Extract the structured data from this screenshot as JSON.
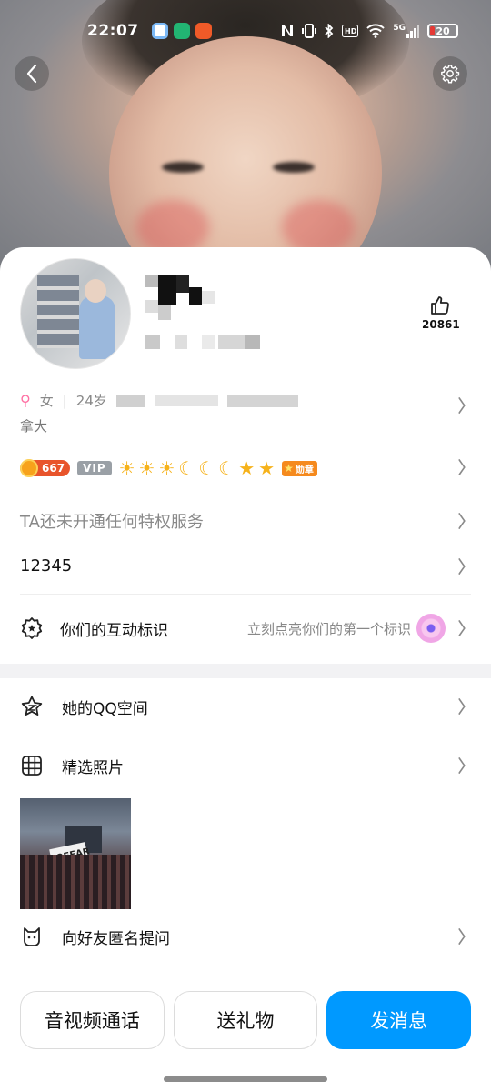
{
  "status_bar": {
    "time": "22:07",
    "network": "5G",
    "battery": "20"
  },
  "header": {
    "back_icon": "chevron-left-icon",
    "settings_icon": "gear-icon"
  },
  "profile": {
    "likes_count": "20861",
    "gender_symbol": "♀",
    "gender": "女",
    "age": "24岁",
    "location_line2": "拿大",
    "level": "667",
    "vip_label": "VIP",
    "medal_label": "勋章"
  },
  "rows": {
    "privilege": "TA还未开通任何特权服务",
    "qq_number": "12345",
    "interact_label": "你们的互动标识",
    "interact_hint": "立刻点亮你们的第一个标识",
    "qzone_label": "她的QQ空间",
    "photos_label": "精选照片",
    "ask_label": "向好友匿名提问"
  },
  "photo": {
    "sign_text": "NOFEAR"
  },
  "actions": {
    "call": "音视频通话",
    "gift": "送礼物",
    "message": "发消息"
  },
  "colors": {
    "primary": "#0099ff",
    "level_badge": "#e8542b",
    "vip_badge": "#9aa0a6"
  }
}
